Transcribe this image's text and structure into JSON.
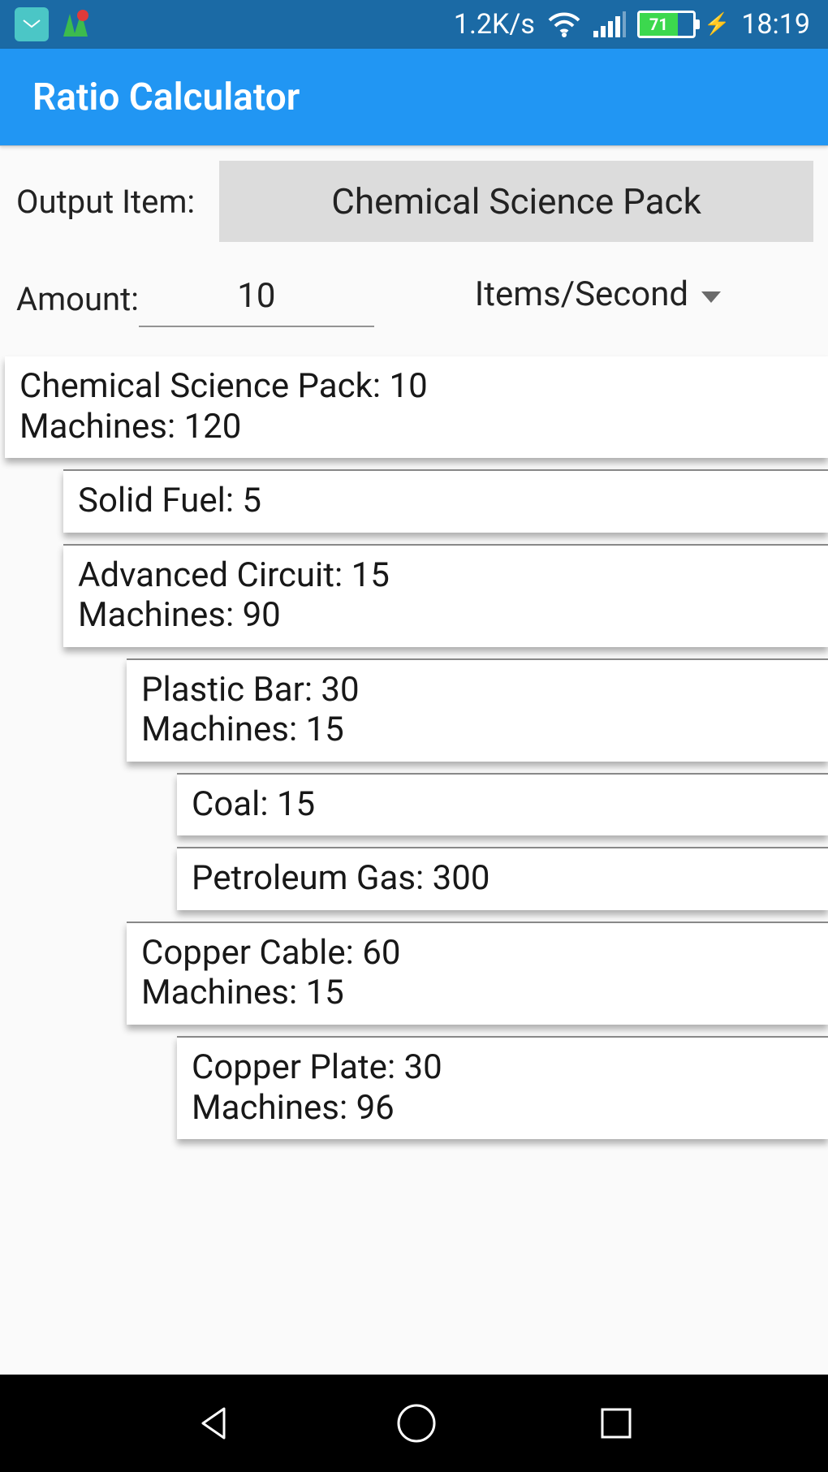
{
  "status_bar": {
    "data_rate": "1.2K/s",
    "battery_pct": "71",
    "time": "18:19"
  },
  "app_bar": {
    "title": "Ratio Calculator"
  },
  "form": {
    "output_label": "Output Item:",
    "output_value": "Chemical Science Pack",
    "amount_label": "Amount:",
    "amount_value": "10",
    "unit_value": "Items/Second"
  },
  "tree": {
    "root": {
      "line1": "Chemical Science Pack: 10",
      "line2": "Machines: 120"
    },
    "solid_fuel": {
      "line1": "Solid Fuel: 5"
    },
    "adv_circuit": {
      "line1": "Advanced Circuit: 15",
      "line2": "Machines: 90"
    },
    "plastic_bar": {
      "line1": "Plastic Bar: 30",
      "line2": "Machines: 15"
    },
    "coal": {
      "line1": "Coal: 15"
    },
    "petroleum": {
      "line1": "Petroleum Gas: 300"
    },
    "copper_cable": {
      "line1": "Copper Cable: 60",
      "line2": "Machines: 15"
    },
    "copper_plate": {
      "line1": "Copper Plate: 30",
      "line2": "Machines: 96"
    }
  }
}
